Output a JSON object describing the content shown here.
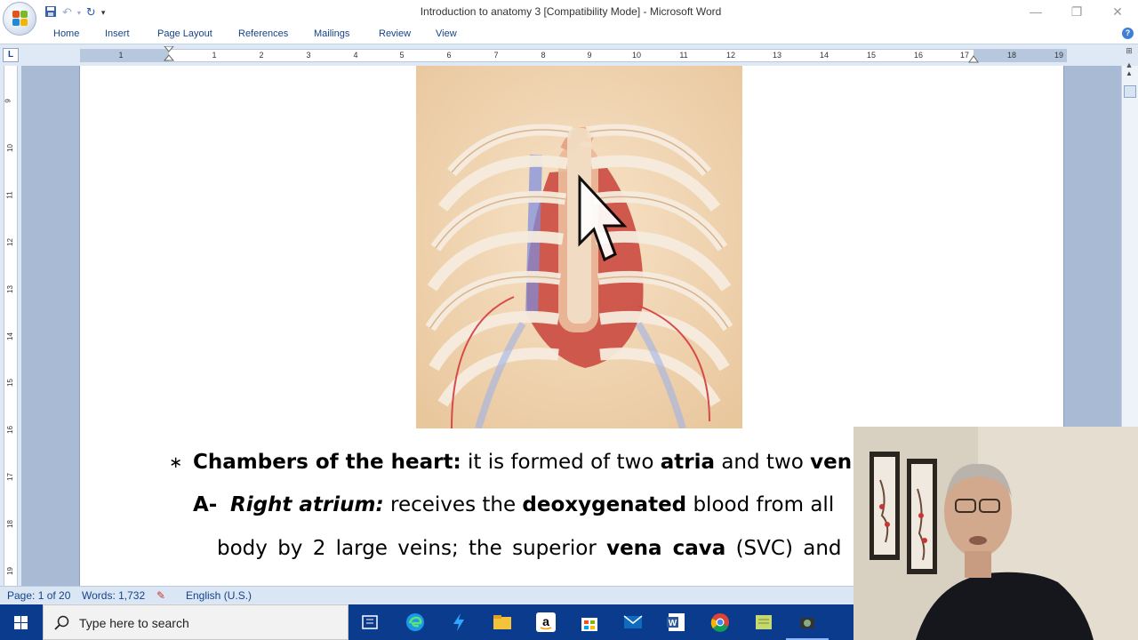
{
  "window": {
    "title": "Introduction to anatomy 3 [Compatibility Mode] - Microsoft Word",
    "controls": [
      "—",
      "❐",
      "✕"
    ]
  },
  "quick_access": [
    "save-icon",
    "undo-icon",
    "redo-icon",
    "customize-icon"
  ],
  "ribbon_tabs": [
    "Home",
    "Insert",
    "Page Layout",
    "References",
    "Mailings",
    "Review",
    "View"
  ],
  "ruler": {
    "corner_label": "L",
    "horizontal_numbers": [
      "1",
      "1",
      "2",
      "3",
      "4",
      "5",
      "6",
      "7",
      "8",
      "9",
      "10",
      "11",
      "12",
      "13",
      "14",
      "15",
      "16",
      "17",
      "18",
      "19"
    ],
    "vertical_numbers": [
      "9",
      "10",
      "11",
      "12",
      "13",
      "14",
      "15",
      "16",
      "17",
      "18",
      "19"
    ]
  },
  "document": {
    "line1": {
      "bullet": "∗",
      "bold_a": "Chambers of the heart:",
      "plain_a": " it is formed of two ",
      "bold_b": "atria",
      "plain_b": " and two ",
      "bold_c": "ven"
    },
    "line2": {
      "prefix": "A-",
      "italic_bold": "Right atrium:",
      "plain_a": " receives the ",
      "bold_a": "deoxygenated",
      "plain_b": " blood from all"
    },
    "line3": {
      "plain_a": "body by 2 large veins; the superior ",
      "bold_a": "vena cava",
      "plain_b": " (SVC) and"
    }
  },
  "status_bar": {
    "page": "Page: 1 of 20",
    "words": "Words: 1,732",
    "language": "English (U.S.)"
  },
  "taskbar": {
    "search_placeholder": "Type here to search",
    "apps": [
      "task-view-icon",
      "edge-icon",
      "app-icon",
      "file-explorer-icon",
      "amazon-icon",
      "store-icon",
      "mail-icon",
      "word-icon",
      "chrome-icon",
      "notes-icon",
      "camera-app-icon"
    ]
  },
  "colors": {
    "ribbon_text": "#15428b",
    "doc_background": "#a9bbd4",
    "taskbar": "#0b3b8c"
  }
}
